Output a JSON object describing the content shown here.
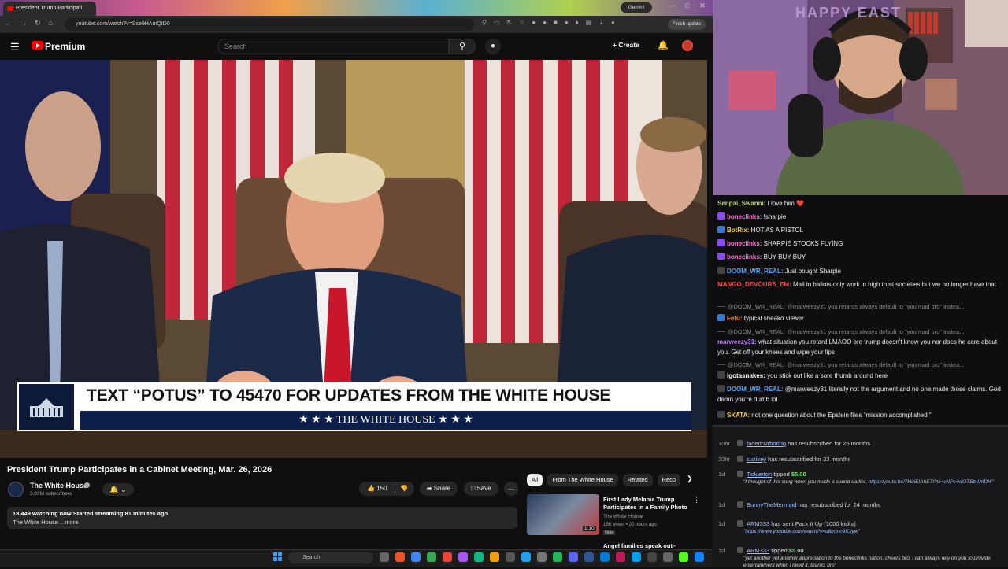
{
  "browser": {
    "tab_title": "President Trump Participati",
    "gemini_label": "Gemini",
    "url": "youtube.com/watch?v=Sse9HAmQtD0",
    "finish_update": "Finish update"
  },
  "youtube": {
    "logo_text": "Premium",
    "search_placeholder": "Search",
    "create_label": "Create",
    "video": {
      "lower_third_text": "TEXT “POTUS” TO 45470 FOR UPDATES FROM THE WHITE HOUSE",
      "lower_third_brand": "★ ★ ★  THE WHITE HOUSE  ★ ★ ★"
    },
    "title": "President Trump Participates in a Cabinet Meeting, Mar. 26, 2026",
    "channel": {
      "name": "The White House",
      "subs": "3.03M subscribers"
    },
    "likes": "150",
    "share_label": "Share",
    "save_label": "Save",
    "description": {
      "line1": "18,449 watching now  Started streaming 81 minutes ago",
      "line2": "The White House ...more"
    },
    "chips": [
      {
        "label": "All",
        "active": true
      },
      {
        "label": "From The White House",
        "active": false
      },
      {
        "label": "Related",
        "active": false
      },
      {
        "label": "Reco",
        "active": false
      }
    ],
    "recommended": {
      "title": "First Lady Melania Trump Participates in a Family Photo",
      "channel": "The White House",
      "meta": "15K views • 20 hours ago",
      "badge": "New",
      "duration": "1:10",
      "next_title": "Angel families speak out–"
    }
  },
  "taskbar": {
    "search_label": "Search"
  },
  "stream": {
    "overlay_text": "HAPPY EAST"
  },
  "chat": [
    {
      "user": "Senpai_Swanni:",
      "color": "#b5d66e",
      "text": " I love him ❤️",
      "badge": ""
    },
    {
      "user": "boneclinks:",
      "color": "#ff7ad9",
      "text": " !sharpie",
      "badge": "#9147ff"
    },
    {
      "user": "BotRix:",
      "color": "#ffd23f",
      "text": " HOT AS A PISTOL",
      "badge": "#2d7bd6"
    },
    {
      "user": "boneclinks:",
      "color": "#ff7ad9",
      "text": " SHARPIE STOCKS FLYING",
      "badge": "#9147ff"
    },
    {
      "user": "boneclinks:",
      "color": "#ff7ad9",
      "text": " BUY BUY BUY",
      "badge": "#9147ff"
    },
    {
      "user": "DOOM_WR_REAL:",
      "color": "#5aa8ff",
      "text": " Just bought Sharpie",
      "badge": "#444"
    },
    {
      "user": "MANGO_DEVOURS_EM:",
      "color": "#ff4a4a",
      "text": " Mail in ballots only work in high trust societies but we no longer have that",
      "badge": ""
    },
    {
      "reply": "── @DOOM_WR_REAL: @marweezy31 you retards always default to \"you mad bro\" instea..."
    },
    {
      "user": "Fefu:",
      "color": "#ff8c1a",
      "text": " typical sneako viewer",
      "badge": "#2d7bd6"
    },
    {
      "reply": "── @DOOM_WR_REAL: @marweezy31 you retards always default to \"you mad bro\" instea..."
    },
    {
      "user": "marweezy31:",
      "color": "#c07aff",
      "text": " what situation you retard LMAOO bro trump doesn't know you nor does he care about you. Get off your knees and wipe your lips",
      "badge": ""
    },
    {
      "reply": "── @DOOM_WR_REAL: @marweezy31 you retards always default to \"you mad bro\" instea..."
    },
    {
      "user": "igotasnakes:",
      "color": "#ffffff",
      "text": " you stick out like a sore thumb around here",
      "badge": "#444"
    },
    {
      "user": "DOOM_WR_REAL:",
      "color": "#5aa8ff",
      "text": " @marweezy31 literally not the argument and no one made those claims. God damn you're dumb lol",
      "badge": "#444"
    },
    {
      "user": "SKATA:",
      "color": "#ffcc33",
      "text": " not one question about the Epstein files \"mission accomplished \"",
      "badge": "#444"
    }
  ],
  "events": [
    {
      "time": "10hr",
      "name": "fadednvrboring",
      "text": " has resubscribed for 26 months"
    },
    {
      "time": "20hr",
      "name": "suzikey",
      "text": " has resubscribed for 32 months"
    },
    {
      "time": "1d",
      "name": "Ticklerton",
      "text": " tipped ",
      "amount": "$5.00",
      "note": "\"I thought of this song when you made a sound earlier. ",
      "link": "https://youtu.be/7HqiEtAhE7I?si=vNPc4wOTSb-UnDl4\""
    },
    {
      "time": "1d",
      "name": "BunnyTheMermaid",
      "text": " has resubscribed for 24 months"
    },
    {
      "time": "1d",
      "name": "ARM333",
      "text": " has sent Pack It Up (1000 kicks)",
      "note": "",
      "link": "\"https://www.youtube.com/watch?v=u8mmn9IOiyw\""
    },
    {
      "time": "1d",
      "name": "ARM333",
      "text": " tipped ",
      "amount": "$5.00",
      "note": "\"yet another yet another appreciation to the boneclinks nation, cheers bro, i can always rely on you to provide entertainment when i need it, thanks bro\"",
      "link": ""
    }
  ]
}
